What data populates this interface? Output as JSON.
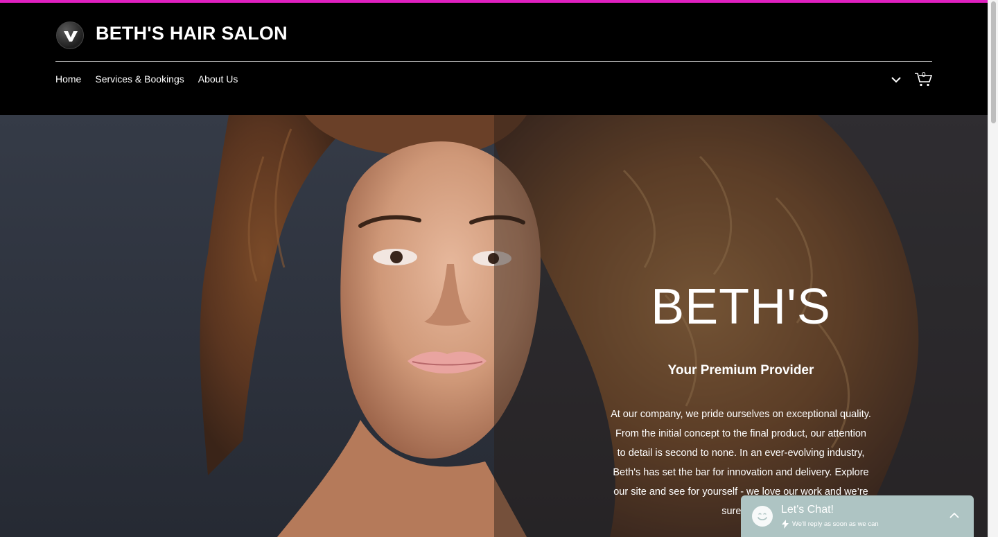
{
  "header": {
    "logo_icon": "v-logo-icon",
    "title": "BETH'S HAIR SALON",
    "nav": [
      {
        "label": "Home"
      },
      {
        "label": "Services & Bookings"
      },
      {
        "label": "About Us"
      }
    ],
    "more_icon": "chevron-down-icon",
    "cart_icon": "cart-icon",
    "cart_count": "0"
  },
  "hero": {
    "brand": "BETH'S",
    "tagline": "Your Premium Provider",
    "body_lines": [
      "At our company, we pride ourselves on exceptional quality.",
      "From the initial concept to the final product, our attention",
      "to detail is second to none. In an ever-evolving industry,",
      "Beth's has set the bar for innovation and delivery. Explore",
      "our site and see for yourself - we love our work and we’re",
      "sure you"
    ]
  },
  "chat": {
    "title": "Let's Chat!",
    "subtitle": "We'll reply as soon as we can",
    "avatar_icon": "smiley-icon",
    "bolt_icon": "lightning-icon",
    "toggle_icon": "chevron-up-icon"
  },
  "colors": {
    "accent_strip": "#e020c0",
    "header_bg": "#000000",
    "chat_bg": "#aec4c3"
  }
}
